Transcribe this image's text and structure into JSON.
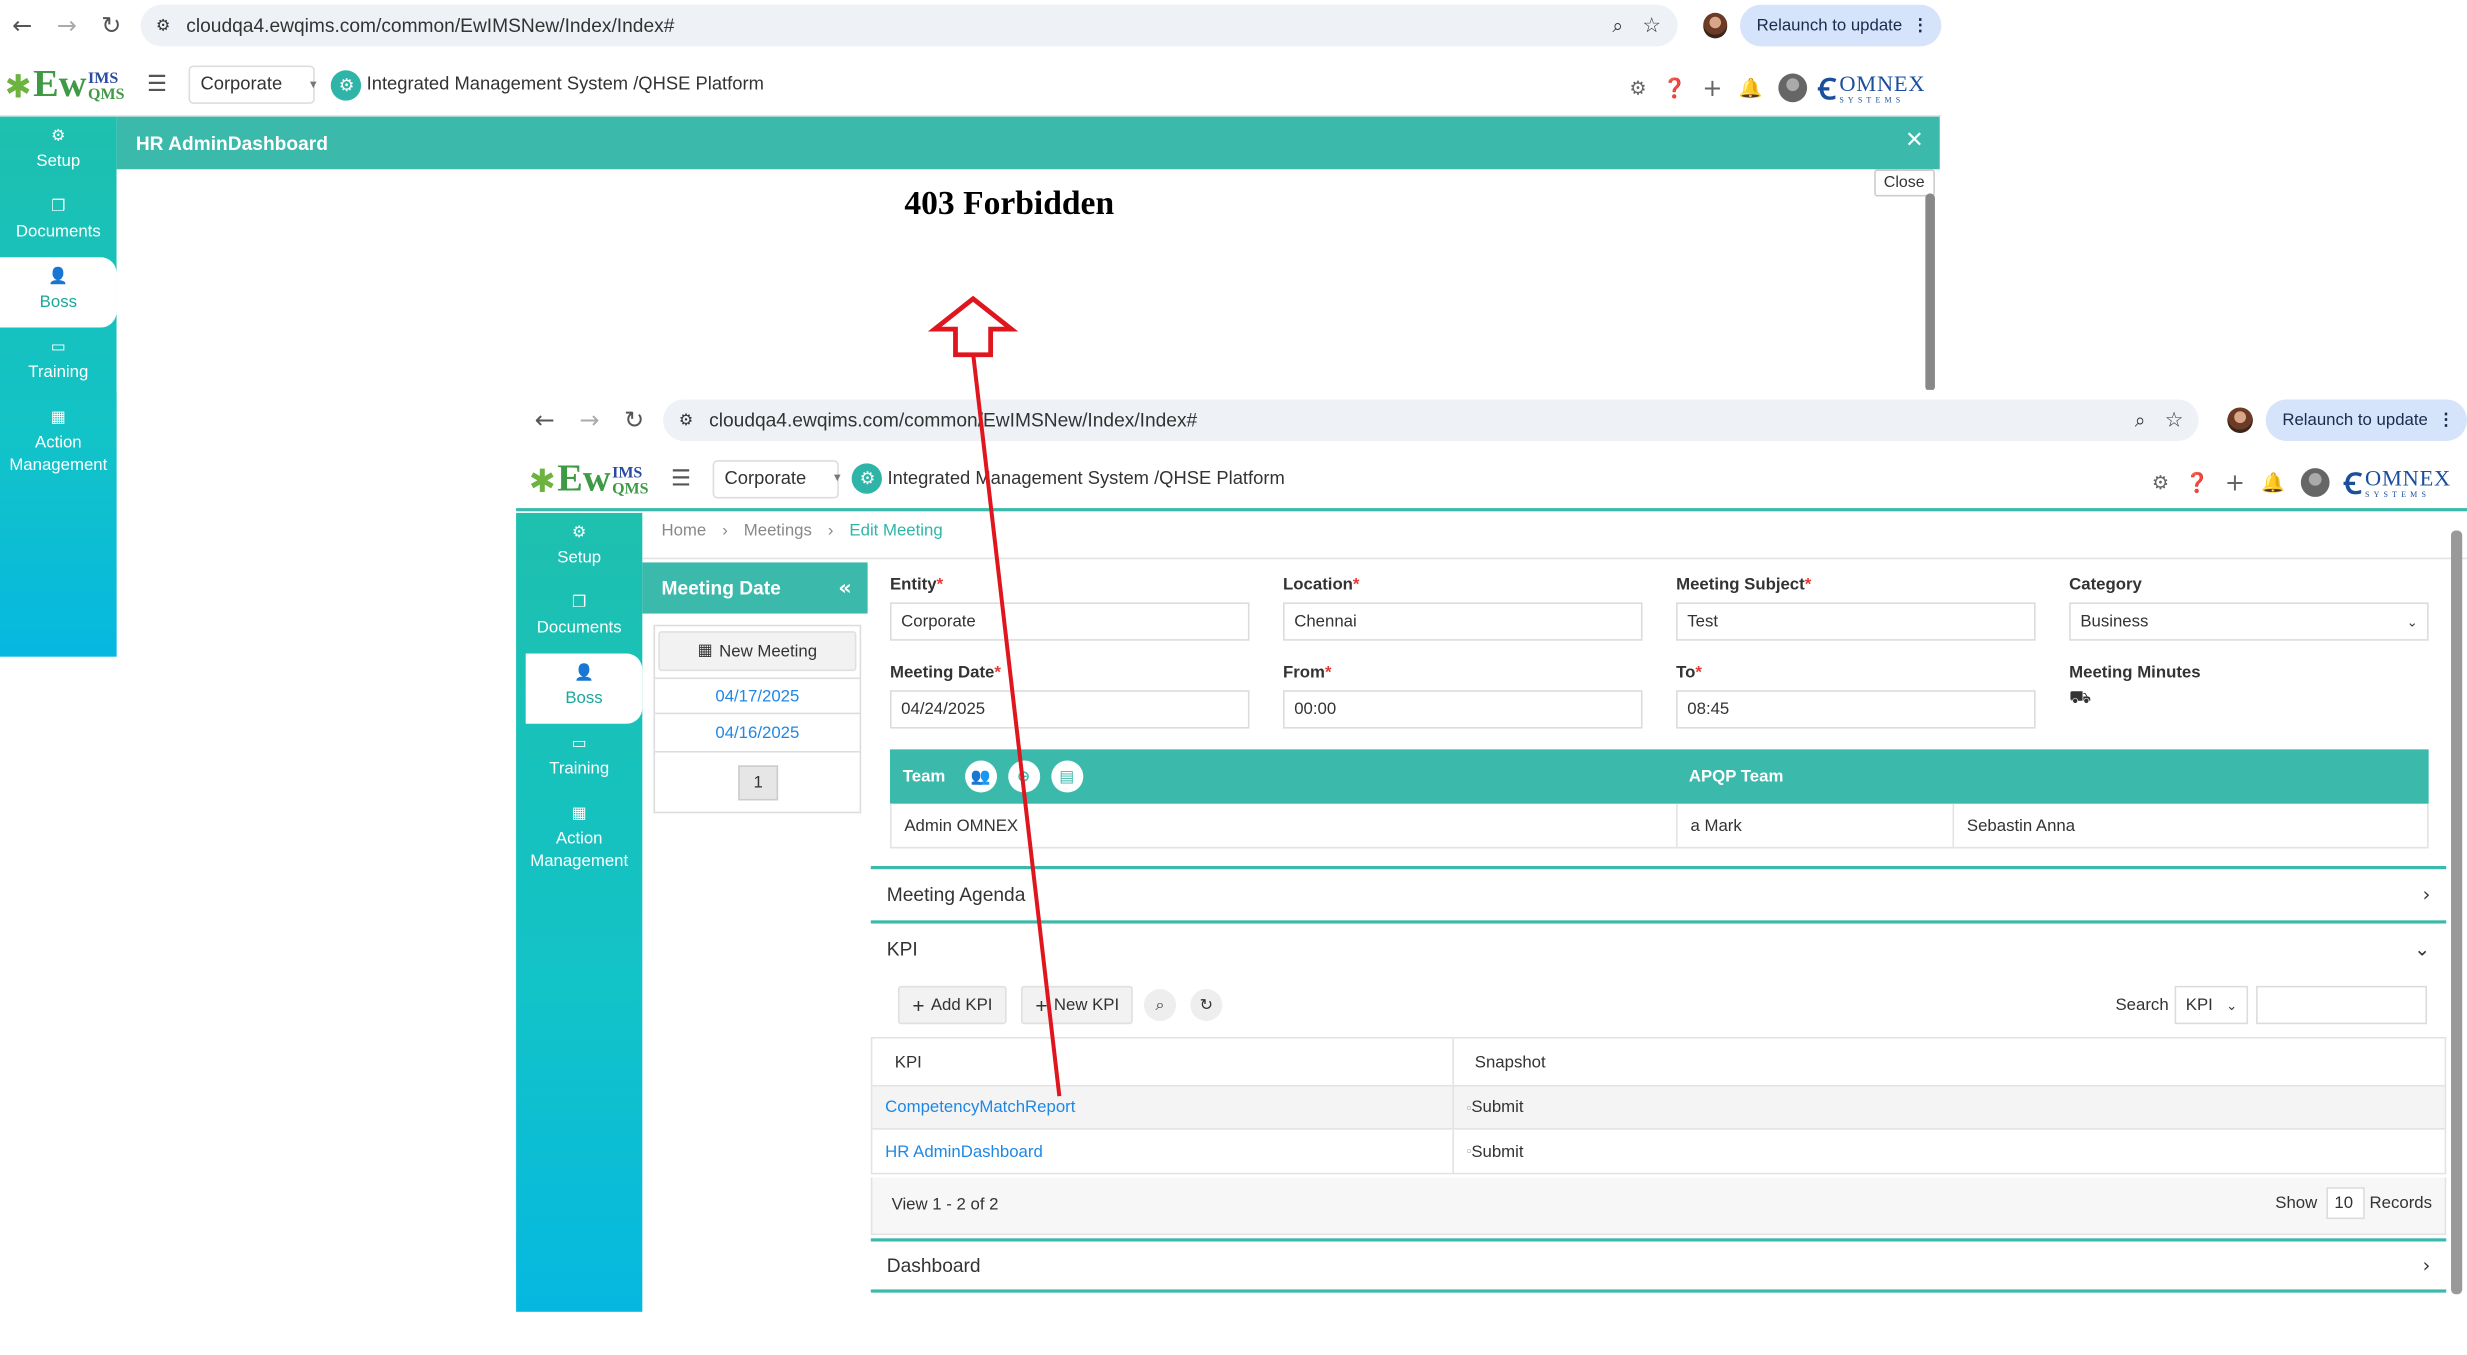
{
  "top": {
    "browser": {
      "url": "cloudqa4.ewqims.com/common/EwIMSNew/Index/Index#",
      "relaunch_label": "Relaunch to update"
    },
    "app": {
      "entity_select": "Corporate",
      "platform_title": "Integrated Management System /QHSE Platform",
      "logo_text": "Ew",
      "logo_sup": "IMS",
      "logo_sub": "QMS",
      "brand": "OMNEX",
      "brand_sub": "SYSTEMS"
    },
    "sidebar": [
      {
        "label": "Setup",
        "icon": "cogs-icon"
      },
      {
        "label": "Documents",
        "icon": "copy-icon"
      },
      {
        "label": "Boss",
        "icon": "user-icon",
        "active": true
      },
      {
        "label": "Training",
        "icon": "chalkboard-icon"
      },
      {
        "label": "Action Management",
        "icon": "building-icon"
      }
    ],
    "dialog": {
      "title": "HR AdminDashboard",
      "close_tooltip": "Close",
      "error_text": "403 Forbidden"
    }
  },
  "bottom": {
    "browser": {
      "url": "cloudqa4.ewqims.com/common/EwIMSNew/Index/Index#",
      "relaunch_label": "Relaunch to update"
    },
    "app": {
      "entity_select": "Corporate",
      "platform_title": "Integrated Management System /QHSE Platform"
    },
    "sidebar": [
      {
        "label": "Setup"
      },
      {
        "label": "Documents"
      },
      {
        "label": "Boss",
        "active": true
      },
      {
        "label": "Training"
      },
      {
        "label": "Action Management"
      }
    ],
    "breadcrumb": [
      "Home",
      "Meetings",
      "Edit Meeting"
    ],
    "left_panel": {
      "title": "Meeting Date",
      "new_meeting": "New Meeting",
      "dates": [
        "04/17/2025",
        "04/16/2025"
      ],
      "page": "1"
    },
    "form": {
      "entity_label": "Entity",
      "entity_value": "Corporate",
      "location_label": "Location",
      "location_value": "Chennai",
      "subject_label": "Meeting Subject",
      "subject_value": "Test",
      "category_label": "Category",
      "category_value": "Business",
      "date_label": "Meeting Date",
      "date_value": "04/24/2025",
      "from_label": "From",
      "from_value": "00:00",
      "to_label": "To",
      "to_value": "08:45",
      "minutes_label": "Meeting Minutes"
    },
    "team": {
      "team_label": "Team",
      "apqp_label": "APQP Team",
      "team_member": "Admin OMNEX",
      "apqp_members": [
        "a Mark",
        "Sebastin Anna"
      ]
    },
    "sections": {
      "agenda": "Meeting Agenda",
      "kpi": "KPI",
      "dashboard": "Dashboard"
    },
    "kpi": {
      "add_kpi": "Add KPI",
      "new_kpi": "New KPI",
      "search_label": "Search",
      "search_field": "KPI",
      "col_kpi": "KPI",
      "col_snapshot": "Snapshot",
      "rows": [
        {
          "kpi": "CompetencyMatchReport",
          "snapshot": "Submit"
        },
        {
          "kpi": "HR AdminDashboard",
          "snapshot": "Submit"
        }
      ],
      "view_info": "View 1 - 2 of 2",
      "show_label": "Show",
      "page_size": "10",
      "records_label": "Records"
    }
  },
  "annotation_color": "#e0161e"
}
